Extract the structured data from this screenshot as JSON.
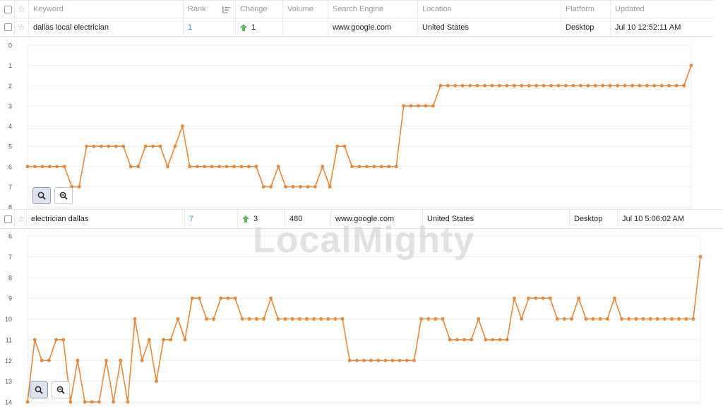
{
  "colors": {
    "series": "#e8893a",
    "link": "#3a8fd1",
    "up_arrow": "#5cb85c",
    "grid": "#eeeeee"
  },
  "header": {
    "keyword": "Keyword",
    "rank": "Rank",
    "change": "Change",
    "volume": "Volume",
    "search_engine": "Search Engine",
    "location": "Location",
    "platform": "Platform",
    "updated": "Updated"
  },
  "rows": [
    {
      "keyword": "dallas local electrician",
      "rank": "1",
      "change": "1",
      "volume": "",
      "search_engine": "www.google.com",
      "location": "United States",
      "platform": "Desktop",
      "updated": "Jul 10 12:52:11 AM"
    },
    {
      "keyword": "electrician dallas",
      "rank": "7",
      "change": "3",
      "volume": "480",
      "search_engine": "www.google.com",
      "location": "United States",
      "platform": "Desktop",
      "updated": "Jul 10 5:06:02 AM"
    }
  ],
  "watermark": "LocalMighty",
  "chart_data": [
    {
      "type": "line",
      "ylim": [
        0,
        8
      ],
      "y_reversed": true,
      "y_ticks": [
        "0",
        "1",
        "2",
        "3",
        "4",
        "5",
        "6",
        "7",
        "8"
      ],
      "grid": true,
      "values": [
        6,
        6,
        6,
        6,
        6,
        6,
        7,
        7,
        5,
        5,
        5,
        5,
        5,
        5,
        6,
        6,
        5,
        5,
        5,
        6,
        5,
        4,
        6,
        6,
        6,
        6,
        6,
        6,
        6,
        6,
        6,
        6,
        7,
        7,
        6,
        7,
        7,
        7,
        7,
        7,
        6,
        7,
        5,
        5,
        6,
        6,
        6,
        6,
        6,
        6,
        6,
        3,
        3,
        3,
        3,
        3,
        2,
        2,
        2,
        2,
        2,
        2,
        2,
        2,
        2,
        2,
        2,
        2,
        2,
        2,
        2,
        2,
        2,
        2,
        2,
        2,
        2,
        2,
        2,
        2,
        2,
        2,
        2,
        2,
        2,
        2,
        2,
        2,
        2,
        2,
        1
      ]
    },
    {
      "type": "line",
      "ylim": [
        6,
        14
      ],
      "y_reversed": true,
      "y_ticks": [
        "6",
        "7",
        "8",
        "9",
        "10",
        "11",
        "12",
        "13",
        "14"
      ],
      "grid": true,
      "values": [
        14,
        11,
        12,
        12,
        11,
        11,
        14,
        12,
        14,
        14,
        14,
        12,
        14,
        12,
        14,
        10,
        12,
        11,
        13,
        11,
        11,
        10,
        11,
        9,
        9,
        10,
        10,
        9,
        9,
        9,
        10,
        10,
        10,
        10,
        9,
        10,
        10,
        10,
        10,
        10,
        10,
        10,
        10,
        10,
        10,
        12,
        12,
        12,
        12,
        12,
        12,
        12,
        12,
        12,
        12,
        10,
        10,
        10,
        10,
        11,
        11,
        11,
        11,
        10,
        11,
        11,
        11,
        11,
        9,
        10,
        9,
        9,
        9,
        9,
        10,
        10,
        10,
        9,
        10,
        10,
        10,
        10,
        9,
        10,
        10,
        10,
        10,
        10,
        10,
        10,
        10,
        10,
        10,
        10,
        7
      ]
    }
  ]
}
